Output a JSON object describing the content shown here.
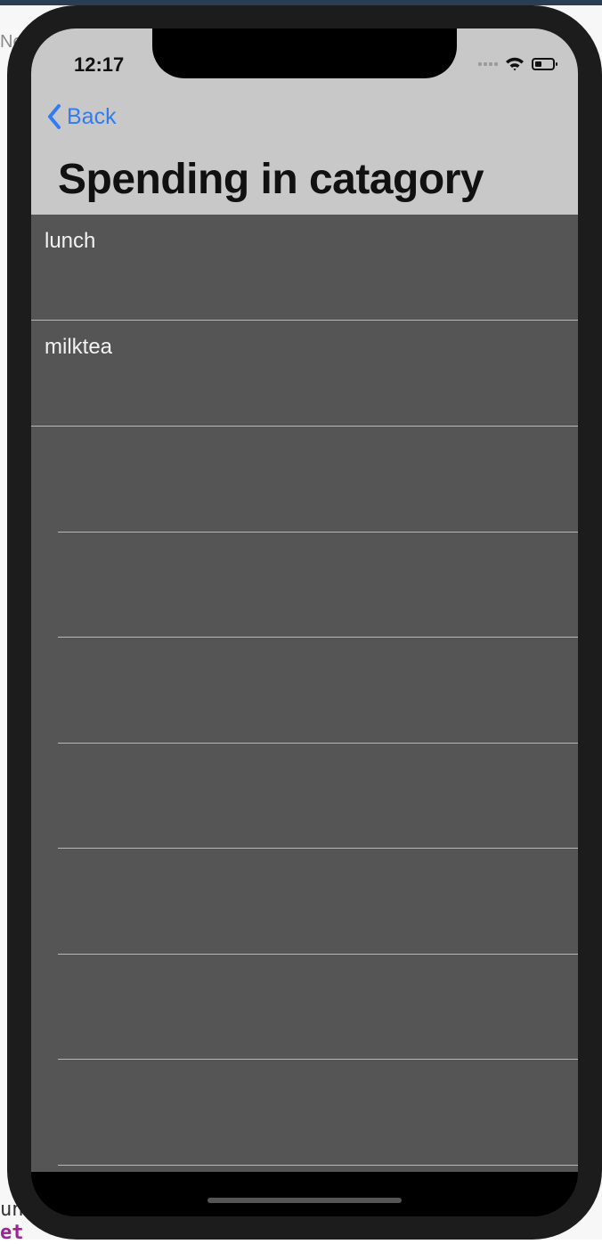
{
  "status_bar": {
    "time": "12:17",
    "signal_icon": "cellular-signal-icon",
    "wifi_icon": "wifi-icon",
    "battery_icon": "battery-icon",
    "battery_level": 0.4
  },
  "nav": {
    "back_label": "Back",
    "back_icon": "chevron-left-icon",
    "title": "Spending in catagory"
  },
  "list": {
    "items": [
      {
        "label": "lunch"
      },
      {
        "label": "milktea"
      }
    ],
    "empty_rows": 7
  },
  "background_editor": {
    "tab_fragment": "Ne",
    "code_fragment_keyword": "et",
    "code_fragment_text": "un"
  },
  "colors": {
    "accent": "#2f7cf6",
    "nav_background": "#c8c8c8",
    "list_background": "#555555",
    "separator": "#b8b8b8",
    "text_light": "#f2f2f2"
  }
}
